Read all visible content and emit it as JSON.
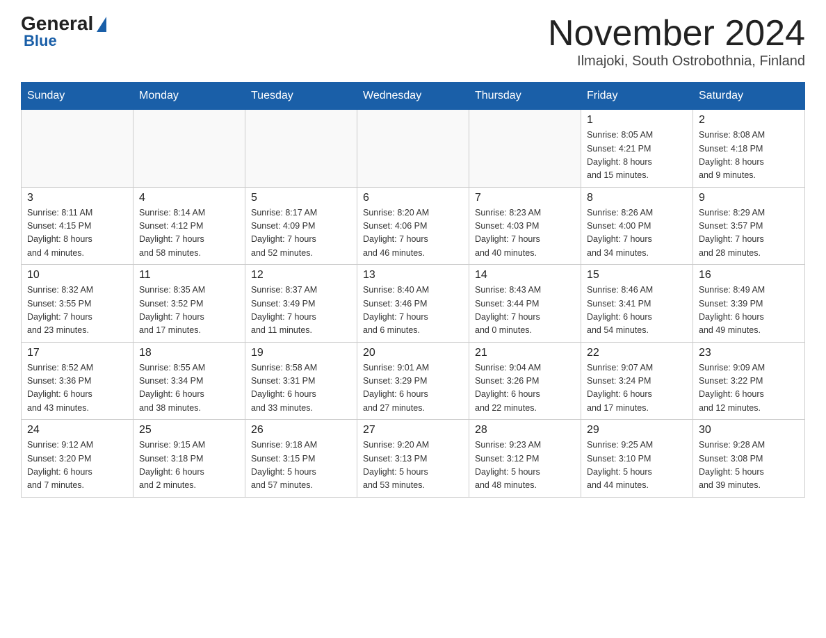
{
  "header": {
    "logo_general": "General",
    "logo_blue": "Blue",
    "month_title": "November 2024",
    "location": "Ilmajoki, South Ostrobothnia, Finland"
  },
  "weekdays": [
    "Sunday",
    "Monday",
    "Tuesday",
    "Wednesday",
    "Thursday",
    "Friday",
    "Saturday"
  ],
  "weeks": [
    [
      {
        "day": "",
        "info": ""
      },
      {
        "day": "",
        "info": ""
      },
      {
        "day": "",
        "info": ""
      },
      {
        "day": "",
        "info": ""
      },
      {
        "day": "",
        "info": ""
      },
      {
        "day": "1",
        "info": "Sunrise: 8:05 AM\nSunset: 4:21 PM\nDaylight: 8 hours\nand 15 minutes."
      },
      {
        "day": "2",
        "info": "Sunrise: 8:08 AM\nSunset: 4:18 PM\nDaylight: 8 hours\nand 9 minutes."
      }
    ],
    [
      {
        "day": "3",
        "info": "Sunrise: 8:11 AM\nSunset: 4:15 PM\nDaylight: 8 hours\nand 4 minutes."
      },
      {
        "day": "4",
        "info": "Sunrise: 8:14 AM\nSunset: 4:12 PM\nDaylight: 7 hours\nand 58 minutes."
      },
      {
        "day": "5",
        "info": "Sunrise: 8:17 AM\nSunset: 4:09 PM\nDaylight: 7 hours\nand 52 minutes."
      },
      {
        "day": "6",
        "info": "Sunrise: 8:20 AM\nSunset: 4:06 PM\nDaylight: 7 hours\nand 46 minutes."
      },
      {
        "day": "7",
        "info": "Sunrise: 8:23 AM\nSunset: 4:03 PM\nDaylight: 7 hours\nand 40 minutes."
      },
      {
        "day": "8",
        "info": "Sunrise: 8:26 AM\nSunset: 4:00 PM\nDaylight: 7 hours\nand 34 minutes."
      },
      {
        "day": "9",
        "info": "Sunrise: 8:29 AM\nSunset: 3:57 PM\nDaylight: 7 hours\nand 28 minutes."
      }
    ],
    [
      {
        "day": "10",
        "info": "Sunrise: 8:32 AM\nSunset: 3:55 PM\nDaylight: 7 hours\nand 23 minutes."
      },
      {
        "day": "11",
        "info": "Sunrise: 8:35 AM\nSunset: 3:52 PM\nDaylight: 7 hours\nand 17 minutes."
      },
      {
        "day": "12",
        "info": "Sunrise: 8:37 AM\nSunset: 3:49 PM\nDaylight: 7 hours\nand 11 minutes."
      },
      {
        "day": "13",
        "info": "Sunrise: 8:40 AM\nSunset: 3:46 PM\nDaylight: 7 hours\nand 6 minutes."
      },
      {
        "day": "14",
        "info": "Sunrise: 8:43 AM\nSunset: 3:44 PM\nDaylight: 7 hours\nand 0 minutes."
      },
      {
        "day": "15",
        "info": "Sunrise: 8:46 AM\nSunset: 3:41 PM\nDaylight: 6 hours\nand 54 minutes."
      },
      {
        "day": "16",
        "info": "Sunrise: 8:49 AM\nSunset: 3:39 PM\nDaylight: 6 hours\nand 49 minutes."
      }
    ],
    [
      {
        "day": "17",
        "info": "Sunrise: 8:52 AM\nSunset: 3:36 PM\nDaylight: 6 hours\nand 43 minutes."
      },
      {
        "day": "18",
        "info": "Sunrise: 8:55 AM\nSunset: 3:34 PM\nDaylight: 6 hours\nand 38 minutes."
      },
      {
        "day": "19",
        "info": "Sunrise: 8:58 AM\nSunset: 3:31 PM\nDaylight: 6 hours\nand 33 minutes."
      },
      {
        "day": "20",
        "info": "Sunrise: 9:01 AM\nSunset: 3:29 PM\nDaylight: 6 hours\nand 27 minutes."
      },
      {
        "day": "21",
        "info": "Sunrise: 9:04 AM\nSunset: 3:26 PM\nDaylight: 6 hours\nand 22 minutes."
      },
      {
        "day": "22",
        "info": "Sunrise: 9:07 AM\nSunset: 3:24 PM\nDaylight: 6 hours\nand 17 minutes."
      },
      {
        "day": "23",
        "info": "Sunrise: 9:09 AM\nSunset: 3:22 PM\nDaylight: 6 hours\nand 12 minutes."
      }
    ],
    [
      {
        "day": "24",
        "info": "Sunrise: 9:12 AM\nSunset: 3:20 PM\nDaylight: 6 hours\nand 7 minutes."
      },
      {
        "day": "25",
        "info": "Sunrise: 9:15 AM\nSunset: 3:18 PM\nDaylight: 6 hours\nand 2 minutes."
      },
      {
        "day": "26",
        "info": "Sunrise: 9:18 AM\nSunset: 3:15 PM\nDaylight: 5 hours\nand 57 minutes."
      },
      {
        "day": "27",
        "info": "Sunrise: 9:20 AM\nSunset: 3:13 PM\nDaylight: 5 hours\nand 53 minutes."
      },
      {
        "day": "28",
        "info": "Sunrise: 9:23 AM\nSunset: 3:12 PM\nDaylight: 5 hours\nand 48 minutes."
      },
      {
        "day": "29",
        "info": "Sunrise: 9:25 AM\nSunset: 3:10 PM\nDaylight: 5 hours\nand 44 minutes."
      },
      {
        "day": "30",
        "info": "Sunrise: 9:28 AM\nSunset: 3:08 PM\nDaylight: 5 hours\nand 39 minutes."
      }
    ]
  ]
}
